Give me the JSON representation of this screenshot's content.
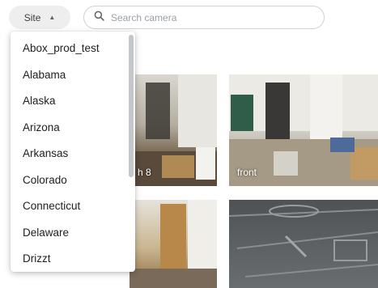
{
  "toolbar": {
    "site_label": "Site",
    "search_placeholder": "Search camera"
  },
  "site_dropdown": {
    "items": [
      "Abox_prod_test",
      "Alabama",
      "Alaska",
      "Arizona",
      "Arkansas",
      "Colorado",
      "Connecticut",
      "Delaware",
      "Drizzt"
    ]
  },
  "cameras": [
    {
      "label": "h 8"
    },
    {
      "label": "front"
    },
    {
      "label": ""
    },
    {
      "label": ""
    }
  ],
  "icons": {
    "site_caret": "caret-up-icon",
    "search": "search-icon"
  }
}
